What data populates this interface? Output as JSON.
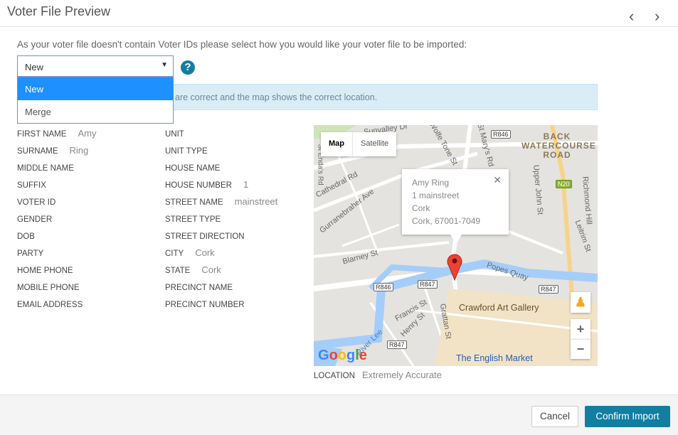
{
  "header": {
    "title": "Voter File Preview",
    "prev_icon": "chevron-left",
    "next_icon": "chevron-right"
  },
  "intro": "As your voter file doesn't contain Voter IDs please select how you would like your voter file to be imported:",
  "import_select": {
    "value": "New",
    "options": [
      "New",
      "Merge"
    ]
  },
  "banner": "are correct and the map shows the correct location.",
  "fields_left": [
    {
      "label": "FIRST NAME",
      "value": "Amy"
    },
    {
      "label": "SURNAME",
      "value": "Ring"
    },
    {
      "label": "MIDDLE NAME",
      "value": ""
    },
    {
      "label": "SUFFIX",
      "value": ""
    },
    {
      "label": "VOTER ID",
      "value": ""
    },
    {
      "label": "GENDER",
      "value": ""
    },
    {
      "label": "DOB",
      "value": ""
    },
    {
      "label": "PARTY",
      "value": ""
    },
    {
      "label": "HOME PHONE",
      "value": ""
    },
    {
      "label": "MOBILE PHONE",
      "value": ""
    },
    {
      "label": "EMAIL ADDRESS",
      "value": ""
    }
  ],
  "fields_right": [
    {
      "label": "UNIT",
      "value": ""
    },
    {
      "label": "UNIT TYPE",
      "value": ""
    },
    {
      "label": "HOUSE NAME",
      "value": ""
    },
    {
      "label": "HOUSE NUMBER",
      "value": "1"
    },
    {
      "label": "STREET NAME",
      "value": "mainstreet"
    },
    {
      "label": "STREET TYPE",
      "value": ""
    },
    {
      "label": "STREET DIRECTION",
      "value": ""
    },
    {
      "label": "CITY",
      "value": "Cork"
    },
    {
      "label": "STATE",
      "value": "Cork"
    },
    {
      "label": "PRECINCT NAME",
      "value": ""
    },
    {
      "label": "PRECINCT NUMBER",
      "value": ""
    }
  ],
  "map": {
    "type_buttons": [
      "Map",
      "Satellite"
    ],
    "info": [
      "Amy Ring",
      "1 mainstreet",
      "Cork",
      "Cork, 67001-7049"
    ],
    "labels": [
      "Sunvalley Dr",
      "Wolfe Tone St",
      "St Mary's Rd",
      "BACK WATERCOURSE ROAD",
      "Cathedral Rd",
      "Gurranebraher Ave",
      "Upper John St",
      "Richmond Hill",
      "Leitrim St",
      "Blarney St",
      "Popes Quay",
      "Crawford Art Gallery",
      "Francis St",
      "Henry St",
      "Grattan St",
      "River Lee",
      "The English Market",
      "St Enda's Rd"
    ],
    "shields": [
      "R846",
      "R846",
      "R847",
      "R847",
      "R847",
      "N20"
    ],
    "logo": "Google"
  },
  "location": {
    "label": "LOCATION",
    "value": "Extremely Accurate"
  },
  "footer": {
    "cancel": "Cancel",
    "confirm": "Confirm Import"
  }
}
